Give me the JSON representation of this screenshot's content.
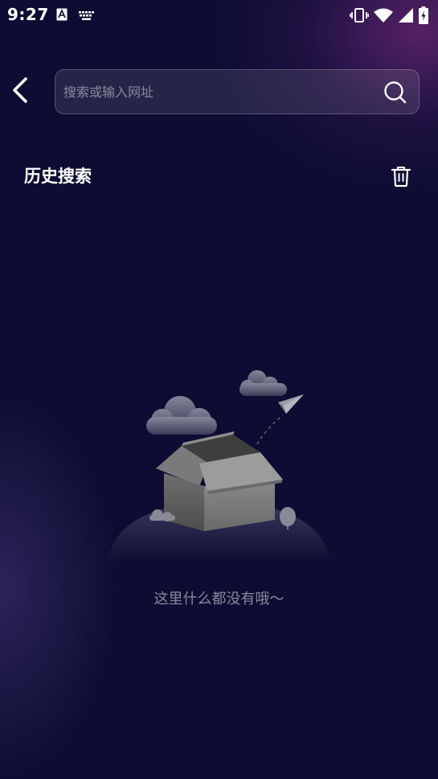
{
  "status_bar": {
    "time": "9:27"
  },
  "header": {
    "search": {
      "placeholder": "搜索或输入网址",
      "value": ""
    }
  },
  "history": {
    "title": "历史搜索"
  },
  "empty_state": {
    "message": "这里什么都没有哦～"
  },
  "icons": {
    "back": "back-arrow-icon",
    "search": "search-icon",
    "trash": "trash-icon",
    "status_left": [
      "text-input-icon",
      "keyboard-icon"
    ],
    "status_right": [
      "vibrate-icon",
      "wifi-icon",
      "signal-icon",
      "battery-charging-icon"
    ]
  },
  "colors": {
    "background": "#0d0d33",
    "accent_glow": "#6e2878"
  }
}
